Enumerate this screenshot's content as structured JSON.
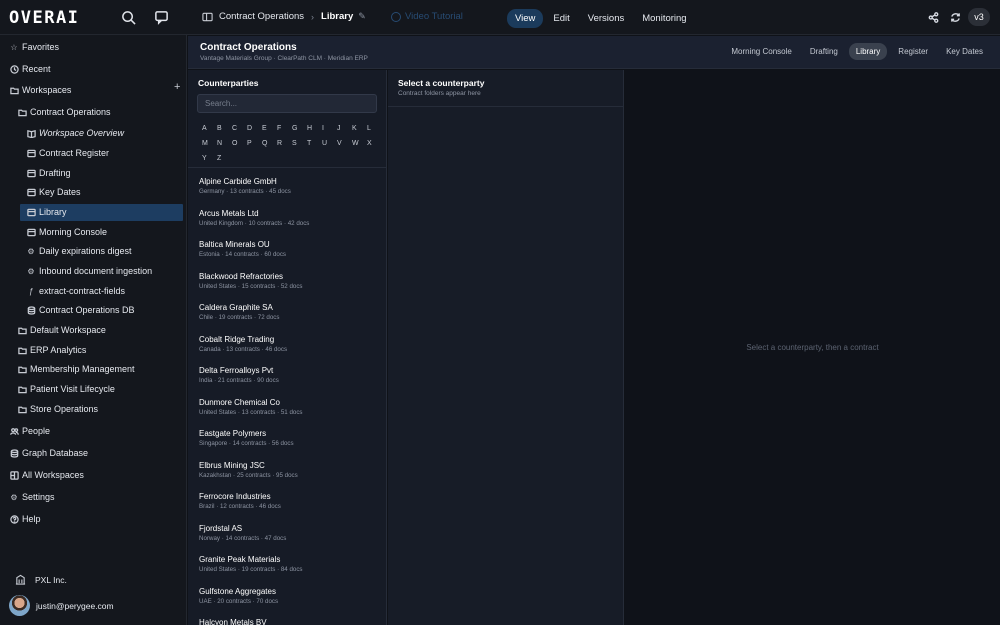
{
  "app": {
    "logo": "OVERAI"
  },
  "topbar": {
    "breadcrumb": [
      "Contract Operations",
      "Library"
    ],
    "video_tutorial": "Video Tutorial",
    "modes": [
      "View",
      "Edit",
      "Versions",
      "Monitoring"
    ],
    "active_mode": "View",
    "version": "v3"
  },
  "sidebar": {
    "favorites": "Favorites",
    "recent": "Recent",
    "workspaces": "Workspaces",
    "contract_operations": "Contract Operations",
    "children": [
      "Workspace Overview",
      "Contract Register",
      "Drafting",
      "Key Dates",
      "Library",
      "Morning Console",
      "Daily expirations digest",
      "Inbound document ingestion",
      "extract-contract-fields",
      "Contract Operations DB"
    ],
    "other_workspaces": [
      "Default Workspace",
      "ERP Analytics",
      "Membership Management",
      "Patient Visit Lifecycle",
      "Store Operations"
    ],
    "bottom": [
      "People",
      "Graph Database",
      "All Workspaces",
      "Settings",
      "Help"
    ],
    "org": "PXL Inc.",
    "user": "justin@perygee.com"
  },
  "header": {
    "title": "Contract Operations",
    "subtitle": "Vantage Materials Group · ClearPath CLM · Meridian ERP",
    "tabs": [
      "Morning Console",
      "Drafting",
      "Library",
      "Register",
      "Key Dates"
    ],
    "active_tab": "Library"
  },
  "counterparties": {
    "title": "Counterparties",
    "search_placeholder": "Search...",
    "letters": [
      "A",
      "B",
      "C",
      "D",
      "E",
      "F",
      "G",
      "H",
      "I",
      "J",
      "K",
      "L",
      "M",
      "N",
      "O",
      "P",
      "Q",
      "R",
      "S",
      "T",
      "U",
      "V",
      "W",
      "X",
      "Y",
      "Z"
    ],
    "items": [
      {
        "name": "Alpine Carbide GmbH",
        "meta": "Germany · 13 contracts · 45 docs"
      },
      {
        "name": "Arcus Metals Ltd",
        "meta": "United Kingdom · 10 contracts · 42 docs"
      },
      {
        "name": "Baltica Minerals OU",
        "meta": "Estonia · 14 contracts · 60 docs"
      },
      {
        "name": "Blackwood Refractories",
        "meta": "United States · 15 contracts · 52 docs"
      },
      {
        "name": "Caldera Graphite SA",
        "meta": "Chile · 19 contracts · 72 docs"
      },
      {
        "name": "Cobalt Ridge Trading",
        "meta": "Canada · 13 contracts · 46 docs"
      },
      {
        "name": "Delta Ferroalloys Pvt",
        "meta": "India · 21 contracts · 90 docs"
      },
      {
        "name": "Dunmore Chemical Co",
        "meta": "United States · 13 contracts · 51 docs"
      },
      {
        "name": "Eastgate Polymers",
        "meta": "Singapore · 14 contracts · 56 docs"
      },
      {
        "name": "Elbrus Mining JSC",
        "meta": "Kazakhstan · 25 contracts · 95 docs"
      },
      {
        "name": "Ferrocore Industries",
        "meta": "Brazil · 12 contracts · 46 docs"
      },
      {
        "name": "Fjordstal AS",
        "meta": "Norway · 14 contracts · 47 docs"
      },
      {
        "name": "Granite Peak Materials",
        "meta": "United States · 19 contracts · 84 docs"
      },
      {
        "name": "Gulfstone Aggregates",
        "meta": "UAE · 20 contracts · 70 docs"
      },
      {
        "name": "Halcyon Metals BV",
        "meta": ""
      }
    ]
  },
  "contracts": {
    "title": "Select a counterparty",
    "subtitle": "Contract folders appear here"
  },
  "detail": {
    "empty": "Select a counterparty, then a contract"
  },
  "colors": {
    "accent": "#1d3d61",
    "background": "#0f1218",
    "panel": "#161b26"
  }
}
